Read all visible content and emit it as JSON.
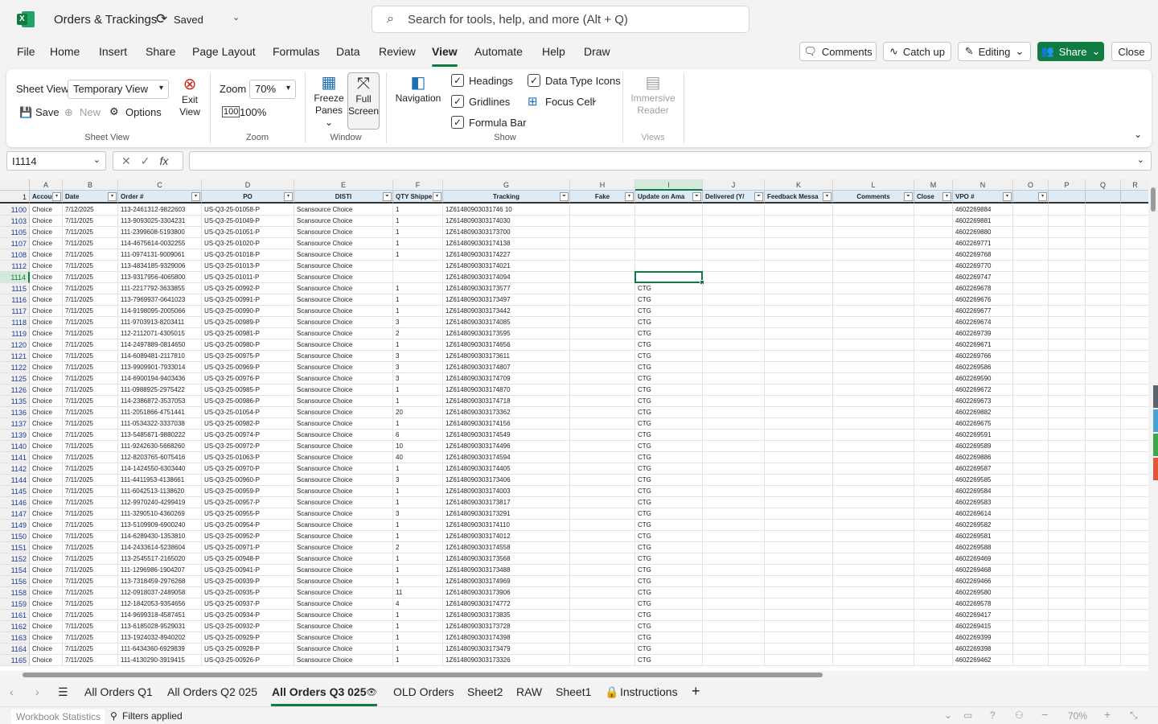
{
  "app": {
    "doc_title": "Orders & Trackings",
    "saved_status": "Saved",
    "search_placeholder": "Search for tools, help, and more (Alt + Q)"
  },
  "menu": {
    "tabs": [
      "File",
      "Home",
      "Insert",
      "Share",
      "Page Layout",
      "Formulas",
      "Data",
      "Review",
      "View",
      "Automate",
      "Help",
      "Draw"
    ],
    "active": "View",
    "comments_label": "Comments",
    "catchup_label": "Catch up",
    "editing_label": "Editing",
    "share_label": "Share",
    "close_label": "Close"
  },
  "ribbon": {
    "sheet_view_label": "Sheet View",
    "sheet_view_value": "Temporary View",
    "save_label": "Save",
    "new_label": "New",
    "options_label": "Options",
    "exit_view_line1": "Exit",
    "exit_view_line2": "View",
    "group_sheet_view": "Sheet View",
    "zoom_label": "Zoom",
    "zoom_value": "70%",
    "zoom_100": "100%",
    "group_zoom": "Zoom",
    "freeze_line1": "Freeze",
    "freeze_line2": "Panes",
    "full_line1": "Full",
    "full_line2": "Screen",
    "group_window": "Window",
    "navigation_label": "Navigation",
    "headings_label": "Headings",
    "gridlines_label": "Gridlines",
    "formula_bar_label": "Formula Bar",
    "data_type_icons_label": "Data Type Icons",
    "focus_cell_label": "Focus Cell",
    "group_show": "Show",
    "immersive_line1": "Immersive",
    "immersive_line2": "Reader",
    "group_views": "Views"
  },
  "formula_bar": {
    "name_box": "I1114",
    "cancel": "✕",
    "enter": "✓",
    "fx": "fx"
  },
  "grid": {
    "col_letters": [
      "A",
      "B",
      "C",
      "D",
      "E",
      "F",
      "G",
      "H",
      "I",
      "J",
      "K",
      "L",
      "M",
      "N",
      "O",
      "P",
      "Q",
      "R"
    ],
    "header_row_number": "1",
    "headers": [
      "Accou",
      "Date",
      "Order #",
      "PO",
      "DISTI",
      "QTY Shippe",
      "Tracking",
      "Fake",
      "Update on Ama",
      "Delivered (Y/",
      "Feedback Messa",
      "Comments",
      "Close",
      "VPO #",
      "",
      "",
      "",
      ""
    ],
    "selected_col": "I",
    "selected_row": "1114",
    "rows": [
      {
        "n": "1100",
        "a": "Choice",
        "b": "7/12/2025",
        "c": "113-2461312-9822603",
        "d": "US-Q3-25-01058-P",
        "e": "Scansource Choice",
        "f": "1",
        "g": "1Z61480903031746 10",
        "i": "",
        "n2": "4602269884"
      },
      {
        "n": "1103",
        "a": "Choice",
        "b": "7/11/2025",
        "c": "113-9093025-3304231",
        "d": "US-Q3-25-01049-P",
        "e": "Scansource Choice",
        "f": "1",
        "g": "1Z6148090303174030",
        "i": "",
        "n2": "4602269881"
      },
      {
        "n": "1105",
        "a": "Choice",
        "b": "7/11/2025",
        "c": "111-2399608-5193800",
        "d": "US-Q3-25-01051-P",
        "e": "Scansource Choice",
        "f": "1",
        "g": "1Z6148090303173700",
        "i": "",
        "n2": "4602269880"
      },
      {
        "n": "1107",
        "a": "Choice",
        "b": "7/11/2025",
        "c": "114-4675614-0032255",
        "d": "US-Q3-25-01020-P",
        "e": "Scansource Choice",
        "f": "1",
        "g": "1Z6148090303174138",
        "i": "",
        "n2": "4602269771"
      },
      {
        "n": "1108",
        "a": "Choice",
        "b": "7/11/2025",
        "c": "111-0974131-9009061",
        "d": "US-Q3-25-01018-P",
        "e": "Scansource Choice",
        "f": "1",
        "g": "1Z6148090303174227",
        "i": "",
        "n2": "4602269768"
      },
      {
        "n": "1112",
        "a": "Choice",
        "b": "7/11/2025",
        "c": "113-4834185-9329006",
        "d": "US-Q3-25-01013-P",
        "e": "Scansource Choice",
        "f": "",
        "g": "1Z6148090303174021",
        "i": "",
        "n2": "4602269770"
      },
      {
        "n": "1114",
        "a": "Choice",
        "b": "7/11/2025",
        "c": "113-9317956-4065800",
        "d": "US-Q3-25-01011-P",
        "e": "Scansource Choice",
        "f": "",
        "g": "1Z6148090303174094",
        "i": "",
        "n2": "4602269747"
      },
      {
        "n": "1115",
        "a": "Choice",
        "b": "7/11/2025",
        "c": "111-2217792-3633855",
        "d": "US-Q3-25-00992-P",
        "e": "Scansource Choice",
        "f": "1",
        "g": "1Z6148090303173577",
        "i": "CTG",
        "n2": "4602269678"
      },
      {
        "n": "1116",
        "a": "Choice",
        "b": "7/11/2025",
        "c": "113-7969937-0641023",
        "d": "US-Q3-25-00991-P",
        "e": "Scansource Choice",
        "f": "1",
        "g": "1Z6148090303173497",
        "i": "CTG",
        "n2": "4602269676"
      },
      {
        "n": "1117",
        "a": "Choice",
        "b": "7/11/2025",
        "c": "114-9198095-2005066",
        "d": "US-Q3-25-00990-P",
        "e": "Scansource Choice",
        "f": "1",
        "g": "1Z6148090303173442",
        "i": "CTG",
        "n2": "4602269677"
      },
      {
        "n": "1118",
        "a": "Choice",
        "b": "7/11/2025",
        "c": "111-9703913-8203411",
        "d": "US-Q3-25-00989-P",
        "e": "Scansource Choice",
        "f": "3",
        "g": "1Z6148090303174085",
        "i": "CTG",
        "n2": "4602269674"
      },
      {
        "n": "1119",
        "a": "Choice",
        "b": "7/11/2025",
        "c": "112-2112071-4305015",
        "d": "US-Q3-25-00981-P",
        "e": "Scansource Choice",
        "f": "2",
        "g": "1Z6148090303173595",
        "i": "CTG",
        "n2": "4602269739"
      },
      {
        "n": "1120",
        "a": "Choice",
        "b": "7/11/2025",
        "c": "114-2497889-0814650",
        "d": "US-Q3-25-00980-P",
        "e": "Scansource Choice",
        "f": "1",
        "g": "1Z6148090303174656",
        "i": "CTG",
        "n2": "4602269671"
      },
      {
        "n": "1121",
        "a": "Choice",
        "b": "7/11/2025",
        "c": "114-6089481-2117810",
        "d": "US-Q3-25-00975-P",
        "e": "Scansource Choice",
        "f": "3",
        "g": "1Z6148090303173611",
        "i": "CTG",
        "n2": "4602269766"
      },
      {
        "n": "1122",
        "a": "Choice",
        "b": "7/11/2025",
        "c": "113-9909901-7933014",
        "d": "US-Q3-25-00969-P",
        "e": "Scansource Choice",
        "f": "3",
        "g": "1Z6148090303174807",
        "i": "CTG",
        "n2": "4602269586"
      },
      {
        "n": "1125",
        "a": "Choice",
        "b": "7/11/2025",
        "c": "114-6900194-9403436",
        "d": "US-Q3-25-00976-P",
        "e": "Scansource Choice",
        "f": "3",
        "g": "1Z6148090303174709",
        "i": "CTG",
        "n2": "4602269590"
      },
      {
        "n": "1126",
        "a": "Choice",
        "b": "7/11/2025",
        "c": "111-0988925-2975422",
        "d": "US-Q3-25-00985-P",
        "e": "Scansource Choice",
        "f": "1",
        "g": "1Z6148090303174870",
        "i": "CTG",
        "n2": "4602269672"
      },
      {
        "n": "1135",
        "a": "Choice",
        "b": "7/11/2025",
        "c": "114-2386872-3537053",
        "d": "US-Q3-25-00986-P",
        "e": "Scansource Choice",
        "f": "1",
        "g": "1Z6148090303174718",
        "i": "CTG",
        "n2": "4602269673"
      },
      {
        "n": "1136",
        "a": "Choice",
        "b": "7/11/2025",
        "c": "111-2051866-4751441",
        "d": "US-Q3-25-01054-P",
        "e": "Scansource Choice",
        "f": "20",
        "g": "1Z6148090303173362",
        "i": "CTG",
        "n2": "4602269882"
      },
      {
        "n": "1137",
        "a": "Choice",
        "b": "7/11/2025",
        "c": "111-0534322-3337038",
        "d": "US-Q3-25-00982-P",
        "e": "Scansource Choice",
        "f": "1",
        "g": "1Z6148090303174156",
        "i": "CTG",
        "n2": "4602269675"
      },
      {
        "n": "1139",
        "a": "Choice",
        "b": "7/11/2025",
        "c": "113-5485671-9880222",
        "d": "US-Q3-25-00974-P",
        "e": "Scansource Choice",
        "f": "6",
        "g": "1Z6148090303174549",
        "i": "CTG",
        "n2": "4602269591"
      },
      {
        "n": "1140",
        "a": "Choice",
        "b": "7/11/2025",
        "c": "111-9242630-5668260",
        "d": "US-Q3-25-00972-P",
        "e": "Scansource Choice",
        "f": "10",
        "g": "1Z6148090303174496",
        "i": "CTG",
        "n2": "4602269589"
      },
      {
        "n": "1141",
        "a": "Choice",
        "b": "7/11/2025",
        "c": "112-8203765-6075416",
        "d": "US-Q3-25-01063-P",
        "e": "Scansource Choice",
        "f": "40",
        "g": "1Z6148090303174594",
        "i": "CTG",
        "n2": "4602269886"
      },
      {
        "n": "1142",
        "a": "Choice",
        "b": "7/11/2025",
        "c": "114-1424550-6303440",
        "d": "US-Q3-25-00970-P",
        "e": "Scansource Choice",
        "f": "1",
        "g": "1Z6148090303174405",
        "i": "CTG",
        "n2": "4602269587"
      },
      {
        "n": "1144",
        "a": "Choice",
        "b": "7/11/2025",
        "c": "111-4411953-4138661",
        "d": "US-Q3-25-00960-P",
        "e": "Scansource Choice",
        "f": "3",
        "g": "1Z6148090303173406",
        "i": "CTG",
        "n2": "4602269585"
      },
      {
        "n": "1145",
        "a": "Choice",
        "b": "7/11/2025",
        "c": "111-6042513-1138620",
        "d": "US-Q3-25-00959-P",
        "e": "Scansource Choice",
        "f": "1",
        "g": "1Z6148090303174003",
        "i": "CTG",
        "n2": "4602269584"
      },
      {
        "n": "1146",
        "a": "Choice",
        "b": "7/11/2025",
        "c": "112-9970240-4299419",
        "d": "US-Q3-25-00957-P",
        "e": "Scansource Choice",
        "f": "1",
        "g": "1Z6148090303173817",
        "i": "CTG",
        "n2": "4602269583"
      },
      {
        "n": "1147",
        "a": "Choice",
        "b": "7/11/2025",
        "c": "111-3290510-4360269",
        "d": "US-Q3-25-00955-P",
        "e": "Scansource Choice",
        "f": "3",
        "g": "1Z6148090303173291",
        "i": "CTG",
        "n2": "4602269614"
      },
      {
        "n": "1149",
        "a": "Choice",
        "b": "7/11/2025",
        "c": "113-5109909-6900240",
        "d": "US-Q3-25-00954-P",
        "e": "Scansource Choice",
        "f": "1",
        "g": "1Z6148090303174110",
        "i": "CTG",
        "n2": "4602269582"
      },
      {
        "n": "1150",
        "a": "Choice",
        "b": "7/11/2025",
        "c": "114-6289430-1353810",
        "d": "US-Q3-25-00952-P",
        "e": "Scansource Choice",
        "f": "1",
        "g": "1Z6148090303174012",
        "i": "CTG",
        "n2": "4602269581"
      },
      {
        "n": "1151",
        "a": "Choice",
        "b": "7/11/2025",
        "c": "114-2433614-5238604",
        "d": "US-Q3-25-00971-P",
        "e": "Scansource Choice",
        "f": "2",
        "g": "1Z6148090303174558",
        "i": "CTG",
        "n2": "4602269588"
      },
      {
        "n": "1152",
        "a": "Choice",
        "b": "7/11/2025",
        "c": "113-2545517-2165020",
        "d": "US-Q3-25-00948-P",
        "e": "Scansource Choice",
        "f": "1",
        "g": "1Z6148090303173568",
        "i": "CTG",
        "n2": "4602269469"
      },
      {
        "n": "1154",
        "a": "Choice",
        "b": "7/11/2025",
        "c": "111-1296986-1904207",
        "d": "US-Q3-25-00941-P",
        "e": "Scansource Choice",
        "f": "1",
        "g": "1Z6148090303173488",
        "i": "CTG",
        "n2": "4602269468"
      },
      {
        "n": "1156",
        "a": "Choice",
        "b": "7/11/2025",
        "c": "113-7318459-2976268",
        "d": "US-Q3-25-00939-P",
        "e": "Scansource Choice",
        "f": "1",
        "g": "1Z6148090303174969",
        "i": "CTG",
        "n2": "4602269466"
      },
      {
        "n": "1158",
        "a": "Choice",
        "b": "7/11/2025",
        "c": "112-0918037-2489058",
        "d": "US-Q3-25-00935-P",
        "e": "Scansource Choice",
        "f": "11",
        "g": "1Z6148090303173906",
        "i": "CTG",
        "n2": "4602269580"
      },
      {
        "n": "1159",
        "a": "Choice",
        "b": "7/11/2025",
        "c": "112-1842053-9354656",
        "d": "US-Q3-25-00937-P",
        "e": "Scansource Choice",
        "f": "4",
        "g": "1Z6148090303174772",
        "i": "CTG",
        "n2": "4602269578"
      },
      {
        "n": "1161",
        "a": "Choice",
        "b": "7/11/2025",
        "c": "114-9699318-4587451",
        "d": "US-Q3-25-00934-P",
        "e": "Scansource Choice",
        "f": "1",
        "g": "1Z6148090303173835",
        "i": "CTG",
        "n2": "4602269417"
      },
      {
        "n": "1162",
        "a": "Choice",
        "b": "7/11/2025",
        "c": "113-6185028-9529031",
        "d": "US-Q3-25-00932-P",
        "e": "Scansource Choice",
        "f": "1",
        "g": "1Z6148090303173728",
        "i": "CTG",
        "n2": "4602269415"
      },
      {
        "n": "1163",
        "a": "Choice",
        "b": "7/11/2025",
        "c": "113-1924032-8940202",
        "d": "US-Q3-25-00929-P",
        "e": "Scansource Choice",
        "f": "1",
        "g": "1Z6148090303174398",
        "i": "CTG",
        "n2": "4602269399"
      },
      {
        "n": "1164",
        "a": "Choice",
        "b": "7/11/2025",
        "c": "111-6434360-6929839",
        "d": "US-Q3-25-00928-P",
        "e": "Scansource Choice",
        "f": "1",
        "g": "1Z6148090303173479",
        "i": "CTG",
        "n2": "4602269398"
      },
      {
        "n": "1165",
        "a": "Choice",
        "b": "7/11/2025",
        "c": "111-4130290-3919415",
        "d": "US-Q3-25-00926-P",
        "e": "Scansource Choice",
        "f": "1",
        "g": "1Z6148090303173326",
        "i": "CTG",
        "n2": "4602269462"
      }
    ]
  },
  "sheets": {
    "tabs": [
      "All Orders Q1",
      "All Orders Q2 025",
      "All Orders Q3 025",
      "OLD Orders",
      "Sheet2",
      "RAW",
      "Sheet1",
      "Instructions"
    ],
    "active": "All Orders Q3 025"
  },
  "status": {
    "workbook_stats": "Workbook Statistics",
    "filters": "Filters applied",
    "zoom": "70%"
  },
  "colors": {
    "accent": "#107c41",
    "header_fill": "#ddebf7"
  }
}
